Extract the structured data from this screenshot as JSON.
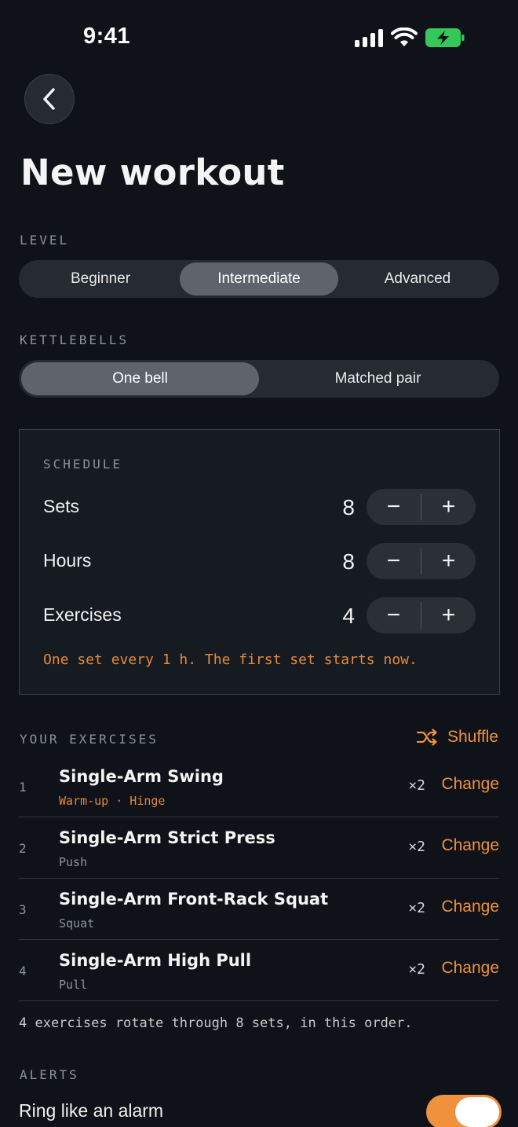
{
  "status_bar": {
    "time": "9:41",
    "icons": [
      "signal-icon",
      "wifi-icon",
      "battery-charging-icon"
    ],
    "battery_color": "#35c759"
  },
  "header": {
    "back_icon": "chevron-left-icon",
    "title": "New workout"
  },
  "level": {
    "label": "LEVEL",
    "options": [
      "Beginner",
      "Intermediate",
      "Advanced"
    ],
    "selected": "Intermediate"
  },
  "kettlebells": {
    "label": "KETTLEBELLS",
    "options": [
      "One bell",
      "Matched pair"
    ],
    "selected": "One bell"
  },
  "schedule": {
    "label": "SCHEDULE",
    "rows": [
      {
        "label": "Sets",
        "value": "8"
      },
      {
        "label": "Hours",
        "value": "8"
      },
      {
        "label": "Exercises",
        "value": "4"
      }
    ],
    "minus": "−",
    "plus": "+",
    "note": "One set every 1 h. The first set starts now."
  },
  "exercises": {
    "label": "YOUR EXERCISES",
    "shuffle_label": "Shuffle",
    "shuffle_icon": "shuffle-icon",
    "items": [
      {
        "index": "1",
        "name": "Single-Arm Swing",
        "tags": "Warm-up · Hinge",
        "mult": "×2",
        "action": "Change"
      },
      {
        "index": "2",
        "name": "Single-Arm Strict Press",
        "tags": "Push",
        "mult": "×2",
        "action": "Change"
      },
      {
        "index": "3",
        "name": "Single-Arm Front-Rack Squat",
        "tags": "Squat",
        "mult": "×2",
        "action": "Change"
      },
      {
        "index": "4",
        "name": "Single-Arm High Pull",
        "tags": "Pull",
        "mult": "×2",
        "action": "Change"
      }
    ],
    "rotation_note": "4 exercises rotate through 8 sets, in this order."
  },
  "alerts": {
    "label": "ALERTS",
    "ring_label": "Ring like an alarm",
    "ring_on": true
  },
  "colors": {
    "accent": "#f0913e",
    "background": "#0f1218",
    "card": "#161a21"
  }
}
